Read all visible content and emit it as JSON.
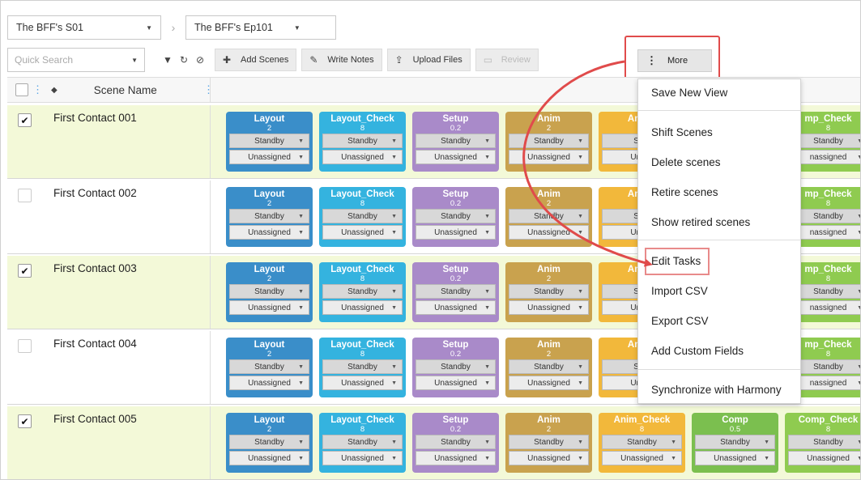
{
  "breadcrumb": {
    "project": "The BFF's S01",
    "episode": "The BFF's Ep101"
  },
  "toolbar": {
    "search_placeholder": "Quick Search",
    "add_scenes": "Add Scenes",
    "write_notes": "Write Notes",
    "upload_files": "Upload Files",
    "review": "Review",
    "more": "More"
  },
  "table": {
    "column_scene_name": "Scene Name"
  },
  "task_names": [
    "Layout",
    "Layout_Check",
    "Setup",
    "Anim",
    "Anim_Check",
    "Comp",
    "Comp_Check"
  ],
  "task_numbers": [
    "2",
    "8",
    "0.2",
    "2",
    "8",
    "0.5",
    "8"
  ],
  "task_colors": [
    "#3a8ec9",
    "#34b3df",
    "#a98ac9",
    "#c9a24e",
    "#f2b83b",
    "#7bbf4f",
    "#8fcb50"
  ],
  "status_default": "Standby",
  "assignee_default": "Unassigned",
  "visible_task_name_truncated": {
    "anim_check": "Anim_",
    "comp_check": "mp_Check"
  },
  "visible_status_truncated": "Stan",
  "visible_assignee_truncated": {
    "anim_check": "Unass",
    "comp_check": "nassigned"
  },
  "rows": [
    {
      "name": "First Contact 001",
      "checked": true
    },
    {
      "name": "First Contact 002",
      "checked": false
    },
    {
      "name": "First Contact 003",
      "checked": true
    },
    {
      "name": "First Contact 004",
      "checked": false
    },
    {
      "name": "First Contact 005",
      "checked": true
    }
  ],
  "more_menu": {
    "save_new_view": "Save New View",
    "shift_scenes": "Shift Scenes",
    "delete_scenes": "Delete scenes",
    "retire_scenes": "Retire scenes",
    "show_retired_scenes": "Show retired scenes",
    "edit_tasks": "Edit Tasks",
    "import_csv": "Import CSV",
    "export_csv": "Export CSV",
    "add_custom_fields": "Add Custom Fields",
    "synchronize": "Synchronize with Harmony"
  },
  "colors": {
    "selected_row": "#f3f9d8",
    "highlight": "#e04b4b"
  },
  "icons": [
    "filter-icon",
    "refresh-icon",
    "cancel-icon",
    "plus-icon",
    "edit-icon",
    "upload-icon",
    "review-icon",
    "more-vertical-icon",
    "chevron-down-icon",
    "sort-icon"
  ]
}
